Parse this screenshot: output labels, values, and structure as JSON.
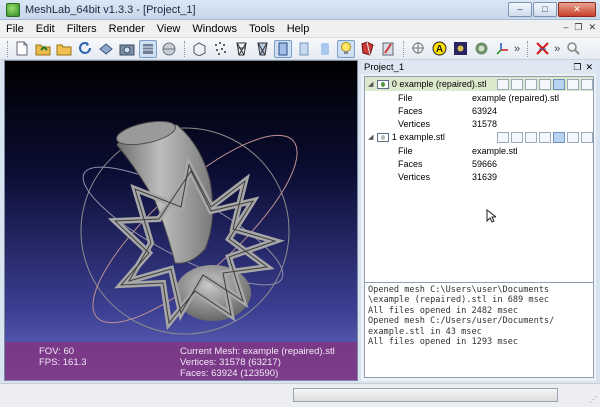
{
  "window": {
    "title": "MeshLab_64bit v1.3.3 - [Project_1]"
  },
  "menu": [
    "File",
    "Edit",
    "Filters",
    "Render",
    "View",
    "Windows",
    "Tools",
    "Help"
  ],
  "toolbar": {
    "buttons": [
      "new-project",
      "open-project",
      "open-mesh",
      "reload",
      "save",
      "snapshot",
      "show-layers",
      "light-toggle",
      "bounding-box",
      "points",
      "wireframe",
      "hidden-lines",
      "flat-lines",
      "flat",
      "smooth",
      "lighting",
      "texture",
      "color",
      "measure",
      "annotation",
      "image",
      "color-picker",
      "axis",
      "delete-selection",
      "search"
    ],
    "more": "»"
  },
  "viewport": {
    "fov_label": "FOV: 60",
    "fps_label": "FPS:  161.3",
    "current_mesh": "Current Mesh: example (repaired).stl",
    "vertices": "Vertices: 31578 (63217)",
    "faces": "Faces: 63924 (123590)"
  },
  "panel": {
    "title": "Project_1",
    "layers": [
      {
        "index": "0",
        "name": "example (repaired).stl",
        "selected": true,
        "props": [
          {
            "key": "File",
            "value": "example (repaired).stl"
          },
          {
            "key": "Faces",
            "value": "63924"
          },
          {
            "key": "Vertices",
            "value": "31578"
          }
        ]
      },
      {
        "index": "1",
        "name": "example.stl",
        "selected": false,
        "props": [
          {
            "key": "File",
            "value": "example.stl"
          },
          {
            "key": "Faces",
            "value": "59666"
          },
          {
            "key": "Vertices",
            "value": "31639"
          }
        ]
      }
    ],
    "log": [
      "Opened mesh C:\\Users\\user\\Documents",
      "\\example (repaired).stl in 689 msec",
      "All files opened in 2482 msec",
      "Opened mesh C:/Users/user/Documents/",
      "example.stl in 43 msec",
      "All files opened in 1293 msec"
    ]
  },
  "colors": {
    "overlay": "#803480",
    "selected_row": "#dde9cc"
  }
}
